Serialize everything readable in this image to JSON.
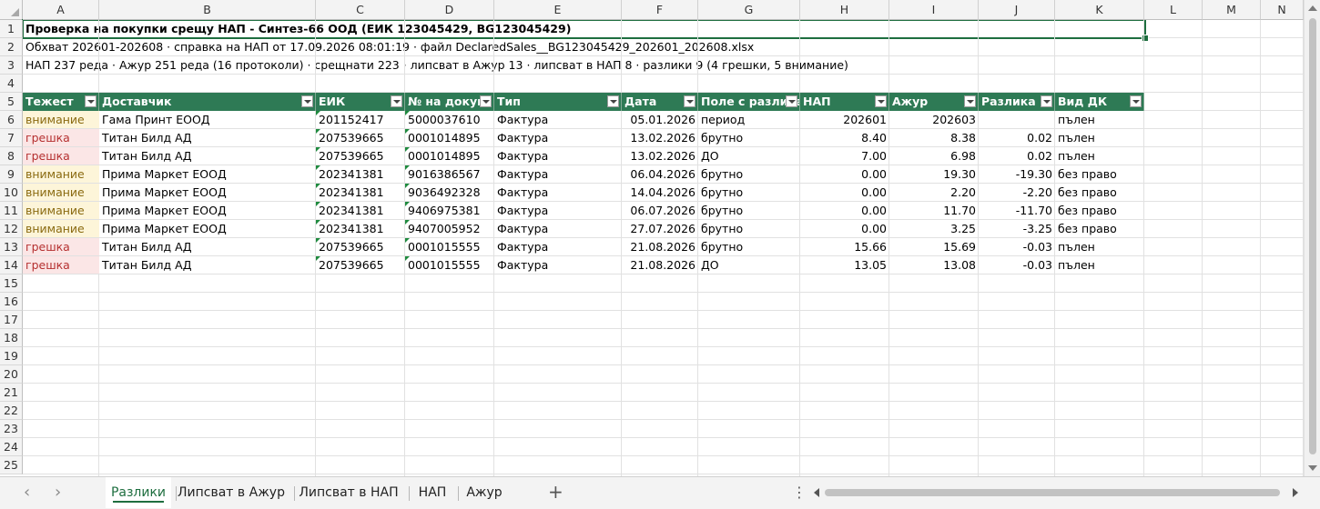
{
  "columns": [
    "A",
    "B",
    "C",
    "D",
    "E",
    "F",
    "G",
    "H",
    "I",
    "J",
    "K",
    "L",
    "M",
    "N"
  ],
  "rows": [
    "1",
    "2",
    "3",
    "4",
    "5",
    "6",
    "7",
    "8",
    "9",
    "10",
    "11",
    "12",
    "13",
    "14",
    "15",
    "16",
    "17",
    "18",
    "19",
    "20",
    "21",
    "22",
    "23",
    "24",
    "25"
  ],
  "title": "Проверка на покупки срещу НАП - Синтез-66 ООД (ЕИК 123045429, BG123045429)",
  "scope_line": "Обхват 202601-202608 · справка на НАП от 17.09.2026 08:01:19 · файл DeclaredSales__BG123045429_202601_202608.xlsx",
  "summary_line": "НАП 237 реда · Ажур 251 реда (16 протоколи) · срещнати 223 · липсват в Ажур 13 · липсват в НАП 8 · разлики 9 (4 грешки, 5 внимание)",
  "table": {
    "headers": [
      "Тежест",
      "Доставчик",
      "ЕИК",
      "№ на докум",
      "Тип",
      "Дата",
      "Поле с разлика",
      "НАП",
      "Ажур",
      "Разлика",
      "Вид ДК"
    ],
    "rows": [
      {
        "sev": "attn",
        "cells": [
          "внимание",
          "Гама Принт ЕООД",
          "201152417",
          "5000037610",
          "Фактура",
          "05.01.2026",
          "период",
          "202601",
          "202603",
          "",
          "пълен"
        ]
      },
      {
        "sev": "err",
        "cells": [
          "грешка",
          "Титан Билд АД",
          "207539665",
          "0001014895",
          "Фактура",
          "13.02.2026",
          "брутно",
          "8.40",
          "8.38",
          "0.02",
          "пълен"
        ]
      },
      {
        "sev": "err",
        "cells": [
          "грешка",
          "Титан Билд АД",
          "207539665",
          "0001014895",
          "Фактура",
          "13.02.2026",
          "ДО",
          "7.00",
          "6.98",
          "0.02",
          "пълен"
        ]
      },
      {
        "sev": "attn",
        "cells": [
          "внимание",
          "Прима Маркет ЕООД",
          "202341381",
          "9016386567",
          "Фактура",
          "06.04.2026",
          "брутно",
          "0.00",
          "19.30",
          "-19.30",
          "без право"
        ]
      },
      {
        "sev": "attn",
        "cells": [
          "внимание",
          "Прима Маркет ЕООД",
          "202341381",
          "9036492328",
          "Фактура",
          "14.04.2026",
          "брутно",
          "0.00",
          "2.20",
          "-2.20",
          "без право"
        ]
      },
      {
        "sev": "attn",
        "cells": [
          "внимание",
          "Прима Маркет ЕООД",
          "202341381",
          "9406975381",
          "Фактура",
          "06.07.2026",
          "брутно",
          "0.00",
          "11.70",
          "-11.70",
          "без право"
        ]
      },
      {
        "sev": "attn",
        "cells": [
          "внимание",
          "Прима Маркет ЕООД",
          "202341381",
          "9407005952",
          "Фактура",
          "27.07.2026",
          "брутно",
          "0.00",
          "3.25",
          "-3.25",
          "без право"
        ]
      },
      {
        "sev": "err",
        "cells": [
          "грешка",
          "Титан Билд АД",
          "207539665",
          "0001015555",
          "Фактура",
          "21.08.2026",
          "брутно",
          "15.66",
          "15.69",
          "-0.03",
          "пълен"
        ]
      },
      {
        "sev": "err",
        "cells": [
          "грешка",
          "Титан Билд АД",
          "207539665",
          "0001015555",
          "Фактура",
          "21.08.2026",
          "ДО",
          "13.05",
          "13.08",
          "-0.03",
          "пълен"
        ]
      }
    ]
  },
  "sheets": [
    "Разлики",
    "Липсват в Ажур",
    "Липсват в НАП",
    "НАП",
    "Ажур"
  ],
  "active_sheet": "Разлики",
  "colors": {
    "header_green": "#2e7a55",
    "attention_bg": "#fdf5d9",
    "error_bg": "#fbe6e6",
    "selection": "#1e6e3f"
  }
}
